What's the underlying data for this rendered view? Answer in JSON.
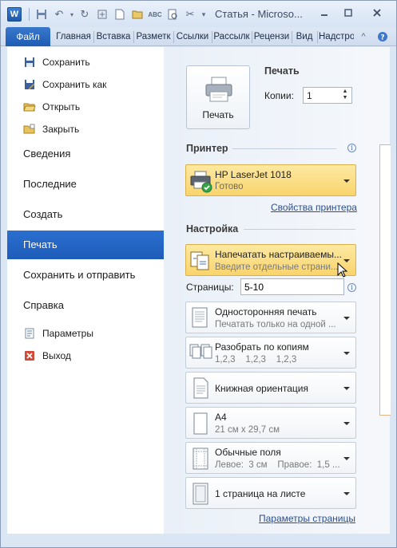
{
  "window": {
    "title": "Статья - Microso...",
    "app_icon_letter": "W"
  },
  "ribbon": {
    "tabs": [
      {
        "label": "Файл",
        "active": true
      },
      {
        "label": "Главная"
      },
      {
        "label": "Вставка"
      },
      {
        "label": "Разметк"
      },
      {
        "label": "Ссылки"
      },
      {
        "label": "Рассылк"
      },
      {
        "label": "Рецензи"
      },
      {
        "label": "Вид"
      },
      {
        "label": "Надстро"
      }
    ]
  },
  "nav": {
    "commands": [
      {
        "label": "Сохранить",
        "icon": "save-icon"
      },
      {
        "label": "Сохранить как",
        "icon": "save-as-icon"
      },
      {
        "label": "Открыть",
        "icon": "open-folder-icon"
      },
      {
        "label": "Закрыть",
        "icon": "close-folder-icon"
      }
    ],
    "items": [
      {
        "label": "Сведения"
      },
      {
        "label": "Последние"
      },
      {
        "label": "Создать"
      },
      {
        "label": "Печать",
        "active": true
      },
      {
        "label": "Сохранить и отправить"
      },
      {
        "label": "Справка"
      }
    ],
    "bottom": [
      {
        "label": "Параметры",
        "icon": "options-icon"
      },
      {
        "label": "Выход",
        "icon": "exit-icon"
      }
    ]
  },
  "print": {
    "heading": "Печать",
    "button_label": "Печать",
    "copies_label": "Копии:",
    "copies_value": "1",
    "printer_heading": "Принтер",
    "printer_name": "HP LaserJet 1018",
    "printer_status": "Готово",
    "printer_props_link": "Свойства принтера",
    "settings_heading": "Настройка",
    "range_title": "Напечатать настраиваемы...",
    "range_sub": "Введите отдельные страни...",
    "pages_label": "Страницы:",
    "pages_value": "5-10",
    "options": [
      {
        "t1": "Односторонняя печать",
        "t2": "Печатать только на одной ..."
      },
      {
        "t1": "Разобрать по копиям",
        "t2": "1,2,3    1,2,3    1,2,3"
      },
      {
        "t1": "Книжная ориентация",
        "t2": ""
      },
      {
        "t1": "A4",
        "t2": "21 см x 29,7 см"
      },
      {
        "t1": "Обычные поля",
        "t2": "Левое:  3 см    Правое:  1,5 ..."
      },
      {
        "t1": "1 страница на листе",
        "t2": ""
      }
    ],
    "page_setup_link": "Параметры страницы"
  }
}
